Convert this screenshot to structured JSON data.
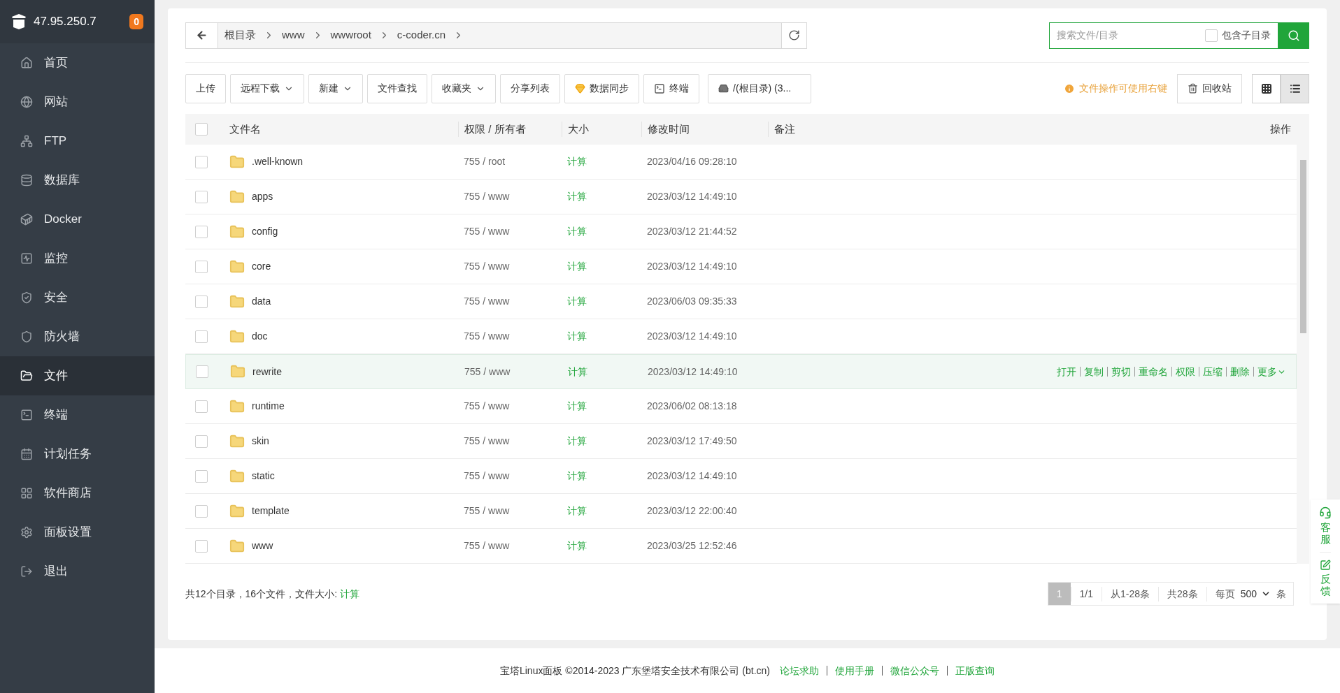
{
  "server": {
    "address": "47.95.250.7",
    "badge": "0"
  },
  "sidebar": {
    "items": [
      {
        "label": "首页",
        "selected": false
      },
      {
        "label": "网站",
        "selected": false
      },
      {
        "label": "FTP",
        "selected": false
      },
      {
        "label": "数据库",
        "selected": false
      },
      {
        "label": "Docker",
        "selected": false
      },
      {
        "label": "监控",
        "selected": false
      },
      {
        "label": "安全",
        "selected": false
      },
      {
        "label": "防火墙",
        "selected": false
      },
      {
        "label": "文件",
        "selected": true
      },
      {
        "label": "终端",
        "selected": false
      },
      {
        "label": "计划任务",
        "selected": false
      },
      {
        "label": "软件商店",
        "selected": false
      },
      {
        "label": "面板设置",
        "selected": false
      },
      {
        "label": "退出",
        "selected": false
      }
    ]
  },
  "breadcrumb": [
    "根目录",
    "www",
    "wwwroot",
    "c-coder.cn"
  ],
  "search": {
    "placeholder": "搜索文件/目录",
    "include_subdirs": {
      "label": "包含子目录",
      "checked": false
    }
  },
  "toolbar": {
    "buttons": [
      {
        "label": "上传",
        "kind": "plain"
      },
      {
        "label": "远程下载",
        "kind": "dropdown"
      },
      {
        "label": "新建",
        "kind": "dropdown"
      },
      {
        "label": "文件查找",
        "kind": "plain"
      },
      {
        "label": "收藏夹",
        "kind": "dropdown"
      },
      {
        "label": "分享列表",
        "kind": "plain"
      },
      {
        "label": "数据同步",
        "kind": "gem"
      },
      {
        "label": "终端",
        "kind": "terminal"
      },
      {
        "label": "/(根目录) (3...",
        "kind": "disk"
      }
    ],
    "hint": "文件操作可使用右键",
    "recycle": "回收站",
    "view_modes": [
      {
        "selected": false
      },
      {
        "selected": true
      }
    ]
  },
  "table": {
    "select_all": {
      "checked": false
    },
    "columns": [
      "文件名",
      "权限 / 所有者",
      "大小",
      "修改时间",
      "备注",
      "操作"
    ],
    "row_actions": [
      "打开",
      "复制",
      "剪切",
      "重命名",
      "权限",
      "压缩",
      "删除",
      "更多"
    ],
    "rows": [
      {
        "name": ".well-known",
        "perm": "755 / root",
        "size": "计算",
        "mtime": "2023/04/16 09:28:10",
        "highlighted": false,
        "checked": false
      },
      {
        "name": "apps",
        "perm": "755 / www",
        "size": "计算",
        "mtime": "2023/03/12 14:49:10",
        "highlighted": false,
        "checked": false
      },
      {
        "name": "config",
        "perm": "755 / www",
        "size": "计算",
        "mtime": "2023/03/12 21:44:52",
        "highlighted": false,
        "checked": false
      },
      {
        "name": "core",
        "perm": "755 / www",
        "size": "计算",
        "mtime": "2023/03/12 14:49:10",
        "highlighted": false,
        "checked": false
      },
      {
        "name": "data",
        "perm": "755 / www",
        "size": "计算",
        "mtime": "2023/06/03 09:35:33",
        "highlighted": false,
        "checked": false
      },
      {
        "name": "doc",
        "perm": "755 / www",
        "size": "计算",
        "mtime": "2023/03/12 14:49:10",
        "highlighted": false,
        "checked": false
      },
      {
        "name": "rewrite",
        "perm": "755 / www",
        "size": "计算",
        "mtime": "2023/03/12 14:49:10",
        "highlighted": true,
        "checked": false
      },
      {
        "name": "runtime",
        "perm": "755 / www",
        "size": "计算",
        "mtime": "2023/06/02 08:13:18",
        "highlighted": false,
        "checked": false
      },
      {
        "name": "skin",
        "perm": "755 / www",
        "size": "计算",
        "mtime": "2023/03/12 17:49:50",
        "highlighted": false,
        "checked": false
      },
      {
        "name": "static",
        "perm": "755 / www",
        "size": "计算",
        "mtime": "2023/03/12 14:49:10",
        "highlighted": false,
        "checked": false
      },
      {
        "name": "template",
        "perm": "755 / www",
        "size": "计算",
        "mtime": "2023/03/12 22:00:40",
        "highlighted": false,
        "checked": false
      },
      {
        "name": "www",
        "perm": "755 / www",
        "size": "计算",
        "mtime": "2023/03/25 12:52:46",
        "highlighted": false,
        "checked": false
      }
    ]
  },
  "summary": {
    "text": "共12个目录，16个文件，文件大小:",
    "link": "计算"
  },
  "pagination": {
    "current": "1",
    "pages": "1/1",
    "range": "从1-28条",
    "total": "共28条",
    "per_page_label": "每页",
    "per_page": "500",
    "unit": "条"
  },
  "footer": {
    "copyright": "宝塔Linux面板 ©2014-2023 广东堡塔安全技术有限公司 (bt.cn)",
    "links": [
      "论坛求助",
      "使用手册",
      "微信公众号",
      "正版查询"
    ]
  },
  "side_widget": [
    "客服",
    "反馈"
  ]
}
